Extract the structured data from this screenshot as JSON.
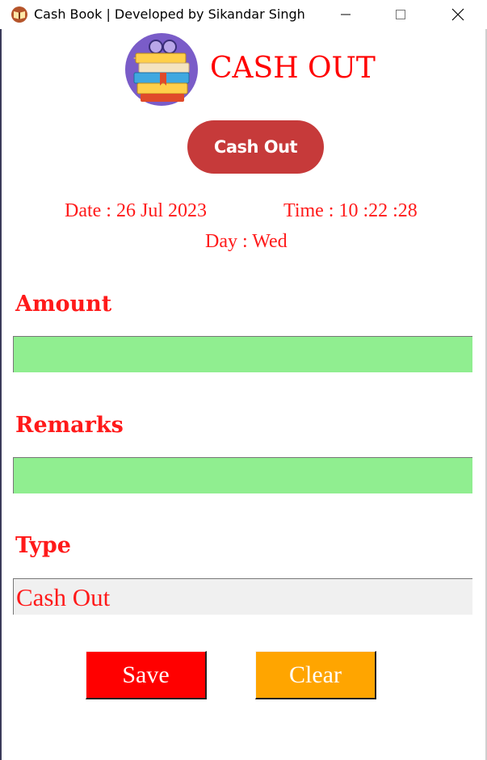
{
  "window": {
    "title": "Cash Book | Developed by Sikandar Singh",
    "icon": "open-book-icon"
  },
  "header": {
    "logo": "books-stack-logo",
    "title": "CASH OUT"
  },
  "mode_button": {
    "label": "Cash Out"
  },
  "info": {
    "date": "Date : 26 Jul 2023",
    "time": "Time : 10 :22 :28",
    "day": "Day : Wed"
  },
  "form": {
    "amount_label": "Amount",
    "amount_value": "",
    "remarks_label": "Remarks",
    "remarks_value": "",
    "type_label": "Type",
    "type_value": "Cash Out"
  },
  "actions": {
    "save_label": "Save",
    "clear_label": "Clear"
  },
  "colors": {
    "accent_red": "#ff0000",
    "pill_red": "#c63a3a",
    "field_green": "#90ee90",
    "clear_orange": "#ffa500"
  }
}
